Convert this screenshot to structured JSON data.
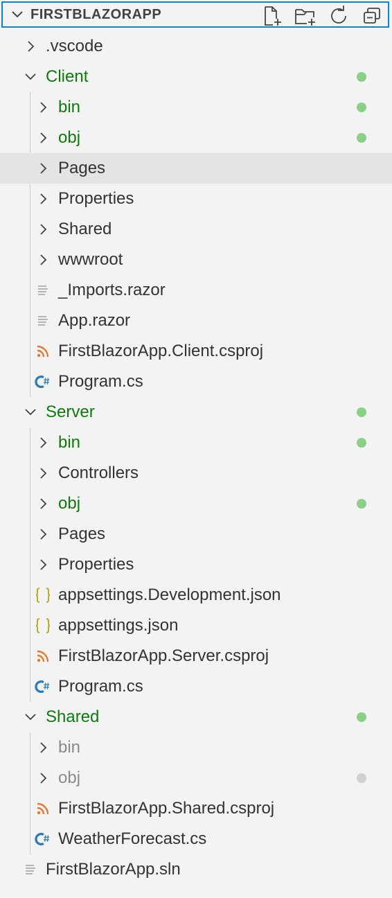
{
  "header": {
    "title": "FIRSTBLAZORAPP",
    "actions": [
      {
        "icon": "new-file-icon"
      },
      {
        "icon": "new-folder-icon"
      },
      {
        "icon": "refresh-icon"
      },
      {
        "icon": "collapse-all-icon"
      }
    ]
  },
  "colors": {
    "modified_text": "#0e7a0d",
    "modified_dot": "#89d185",
    "ignored_text": "#8a8a8a",
    "ignored_dot": "#d0d0d0",
    "csharp_icon": "#2f7bb5",
    "json_icon": "#b5b020",
    "rss_icon": "#e37933",
    "focus_border": "#0a84d6"
  },
  "tree": [
    {
      "label": ".vscode",
      "depth": 0,
      "kind": "folder",
      "state": "normal"
    },
    {
      "label": "Client",
      "depth": 0,
      "kind": "folder-open",
      "state": "modified",
      "dot": true
    },
    {
      "label": "bin",
      "depth": 1,
      "kind": "folder",
      "state": "modified",
      "dot": true
    },
    {
      "label": "obj",
      "depth": 1,
      "kind": "folder",
      "state": "modified",
      "dot": true
    },
    {
      "label": "Pages",
      "depth": 1,
      "kind": "folder",
      "state": "normal",
      "hover": true
    },
    {
      "label": "Properties",
      "depth": 1,
      "kind": "folder",
      "state": "normal"
    },
    {
      "label": "Shared",
      "depth": 1,
      "kind": "folder",
      "state": "normal"
    },
    {
      "label": "wwwroot",
      "depth": 1,
      "kind": "folder",
      "state": "normal"
    },
    {
      "label": "_Imports.razor",
      "depth": 1,
      "kind": "lines",
      "state": "normal"
    },
    {
      "label": "App.razor",
      "depth": 1,
      "kind": "lines",
      "state": "normal"
    },
    {
      "label": "FirstBlazorApp.Client.csproj",
      "depth": 1,
      "kind": "rss",
      "state": "normal"
    },
    {
      "label": "Program.cs",
      "depth": 1,
      "kind": "csharp",
      "state": "normal"
    },
    {
      "label": "Server",
      "depth": 0,
      "kind": "folder-open",
      "state": "modified",
      "dot": true
    },
    {
      "label": "bin",
      "depth": 1,
      "kind": "folder",
      "state": "modified",
      "dot": true
    },
    {
      "label": "Controllers",
      "depth": 1,
      "kind": "folder",
      "state": "normal"
    },
    {
      "label": "obj",
      "depth": 1,
      "kind": "folder",
      "state": "modified",
      "dot": true
    },
    {
      "label": "Pages",
      "depth": 1,
      "kind": "folder",
      "state": "normal"
    },
    {
      "label": "Properties",
      "depth": 1,
      "kind": "folder",
      "state": "normal"
    },
    {
      "label": "appsettings.Development.json",
      "depth": 1,
      "kind": "json",
      "state": "normal"
    },
    {
      "label": "appsettings.json",
      "depth": 1,
      "kind": "json",
      "state": "normal"
    },
    {
      "label": "FirstBlazorApp.Server.csproj",
      "depth": 1,
      "kind": "rss",
      "state": "normal"
    },
    {
      "label": "Program.cs",
      "depth": 1,
      "kind": "csharp",
      "state": "normal"
    },
    {
      "label": "Shared",
      "depth": 0,
      "kind": "folder-open",
      "state": "modified",
      "dot": true
    },
    {
      "label": "bin",
      "depth": 1,
      "kind": "folder",
      "state": "ignored"
    },
    {
      "label": "obj",
      "depth": 1,
      "kind": "folder",
      "state": "ignored",
      "dot": true
    },
    {
      "label": "FirstBlazorApp.Shared.csproj",
      "depth": 1,
      "kind": "rss",
      "state": "normal"
    },
    {
      "label": "WeatherForecast.cs",
      "depth": 1,
      "kind": "csharp",
      "state": "normal"
    },
    {
      "label": "FirstBlazorApp.sln",
      "depth": 0,
      "kind": "lines",
      "state": "normal"
    }
  ]
}
